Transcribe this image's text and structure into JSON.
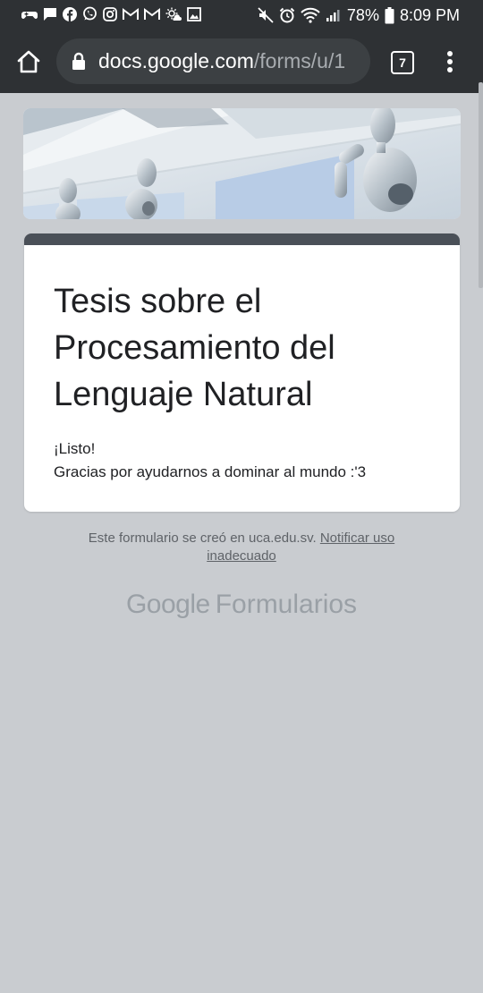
{
  "status_bar": {
    "battery": "78%",
    "time": "8:09 PM",
    "left_icons": [
      "game-controller-icon",
      "message-icon",
      "facebook-icon",
      "whatsapp-icon",
      "instagram-icon",
      "gmail-icon",
      "gmail-icon",
      "weather-icon",
      "image-icon"
    ],
    "right_icons": [
      "mute-icon",
      "alarm-icon",
      "wifi-icon",
      "signal-icon",
      "battery-icon"
    ]
  },
  "browser": {
    "url_domain": "docs.google.com",
    "url_path": "/forms/u/1",
    "tab_count": "7",
    "home_icon": "home-icon",
    "lock_icon": "lock-icon",
    "menu_icon": "more-vert-icon"
  },
  "form": {
    "title": "Tesis sobre el Procesamiento del Lenguaje Natural",
    "message_line1": "¡Listo!",
    "message_line2": "Gracias por ayudarnos a dominar al mundo :'3",
    "accent_color": "#4a5058"
  },
  "footer": {
    "created_text": "Este formulario se creó en uca.edu.sv.",
    "report_link": "Notificar uso inadecuado",
    "logo_google": "Google",
    "logo_forms": "Formularios"
  },
  "colors": {
    "bar_background": "#2e3134",
    "page_background": "#c9ccd0",
    "card_background": "#ffffff"
  }
}
